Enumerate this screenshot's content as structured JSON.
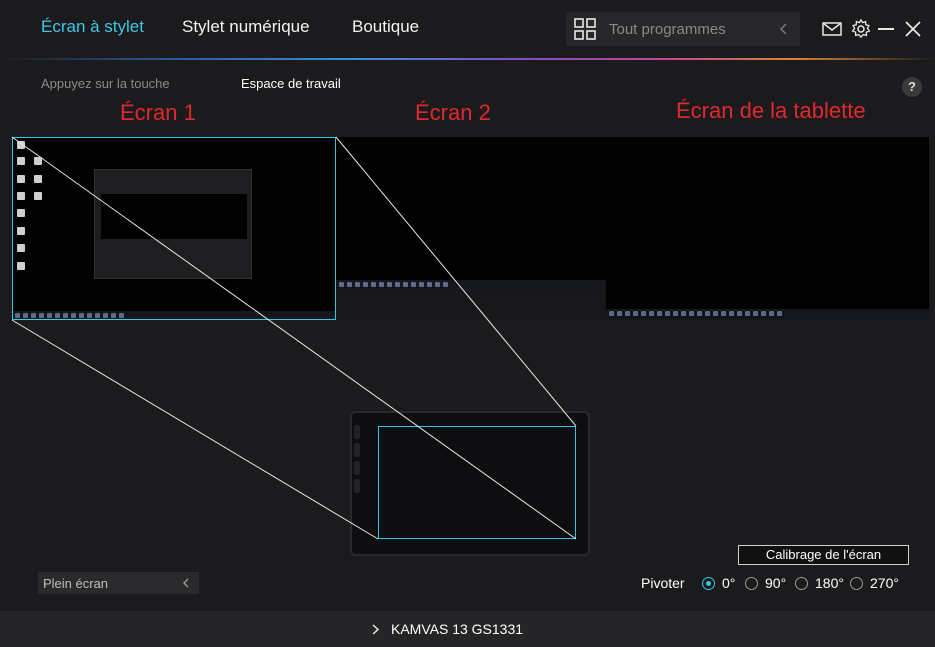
{
  "nav": {
    "tabs": [
      {
        "label": "Écran à stylet",
        "active": true
      },
      {
        "label": "Stylet numérique",
        "active": false
      },
      {
        "label": "Boutique",
        "active": false
      }
    ],
    "search_placeholder": "Tout programmes"
  },
  "icons": [
    "apps-grid-icon",
    "chevron-left-icon",
    "mail-icon",
    "gear-icon",
    "minimize-icon",
    "close-icon",
    "help-icon",
    "chevron-right-icon"
  ],
  "subtabs": [
    {
      "label": "Appuyez sur la touche",
      "active": false
    },
    {
      "label": "Espace de travail",
      "active": true
    }
  ],
  "help_label": "?",
  "screens": [
    {
      "label": "Écran 1",
      "selected": true
    },
    {
      "label": "Écran 2",
      "selected": false
    },
    {
      "label": "Écran de la tablette",
      "selected": false
    }
  ],
  "calibrate_label": "Calibrage de l'écran",
  "mode_dropdown": {
    "value": "Plein écran"
  },
  "pivot": {
    "label": "Pivoter",
    "options": [
      "0°",
      "90°",
      "180°",
      "270°"
    ],
    "selected": "0°"
  },
  "device": {
    "name": "KAMVAS 13 GS1331"
  },
  "colors": {
    "accent": "#34c6e2",
    "active_tab": "#3ec6e6",
    "screen_label": "#e0282e",
    "background": "#1b1b1d"
  }
}
